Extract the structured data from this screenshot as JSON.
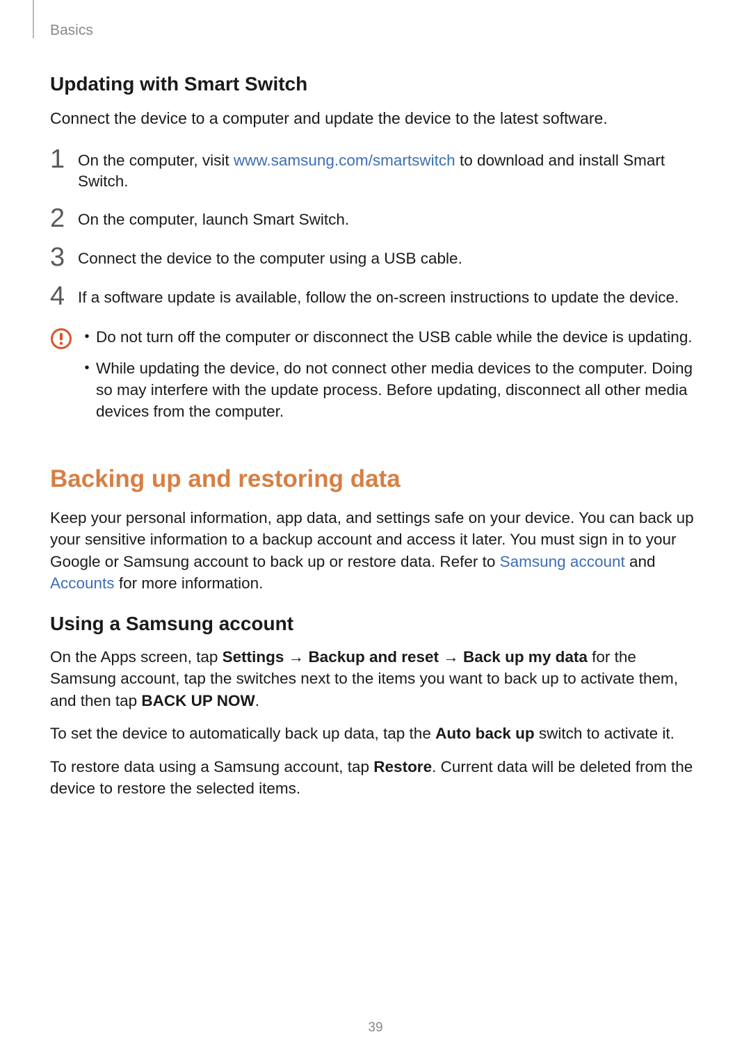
{
  "breadcrumb": "Basics",
  "sec1": {
    "heading": "Updating with Smart Switch",
    "lead": "Connect the device to a computer and update the device to the latest software.",
    "steps": [
      {
        "num": "1",
        "pre": "On the computer, visit ",
        "link": "www.samsung.com/smartswitch",
        "post": " to download and install Smart Switch."
      },
      {
        "num": "2",
        "text": "On the computer, launch Smart Switch."
      },
      {
        "num": "3",
        "text": "Connect the device to the computer using a USB cable."
      },
      {
        "num": "4",
        "text": "If a software update is available, follow the on-screen instructions to update the device."
      }
    ],
    "notice": [
      "Do not turn off the computer or disconnect the USB cable while the device is updating.",
      "While updating the device, do not connect other media devices to the computer. Doing so may interfere with the update process. Before updating, disconnect all other media devices from the computer."
    ]
  },
  "sec2": {
    "heading": "Backing up and restoring data",
    "intro": {
      "pre": "Keep your personal information, app data, and settings safe on your device. You can back up your sensitive information to a backup account and access it later. You must sign in to your Google or Samsung account to back up or restore data. Refer to ",
      "link1": "Samsung account",
      "mid": " and ",
      "link2": "Accounts",
      "post": " for more information."
    },
    "sub": "Using a Samsung account",
    "p1": {
      "a": "On the Apps screen, tap ",
      "b1": "Settings",
      "arrow1": " → ",
      "b2": "Backup and reset",
      "arrow2": " → ",
      "b3": "Back up my data",
      "c": " for the Samsung account, tap the switches next to the items you want to back up to activate them, and then tap ",
      "b4": "BACK UP NOW",
      "d": "."
    },
    "p2": {
      "a": "To set the device to automatically back up data, tap the ",
      "b": "Auto back up",
      "c": " switch to activate it."
    },
    "p3": {
      "a": "To restore data using a Samsung account, tap ",
      "b": "Restore",
      "c": ". Current data will be deleted from the device to restore the selected items."
    }
  },
  "pagenum": "39"
}
